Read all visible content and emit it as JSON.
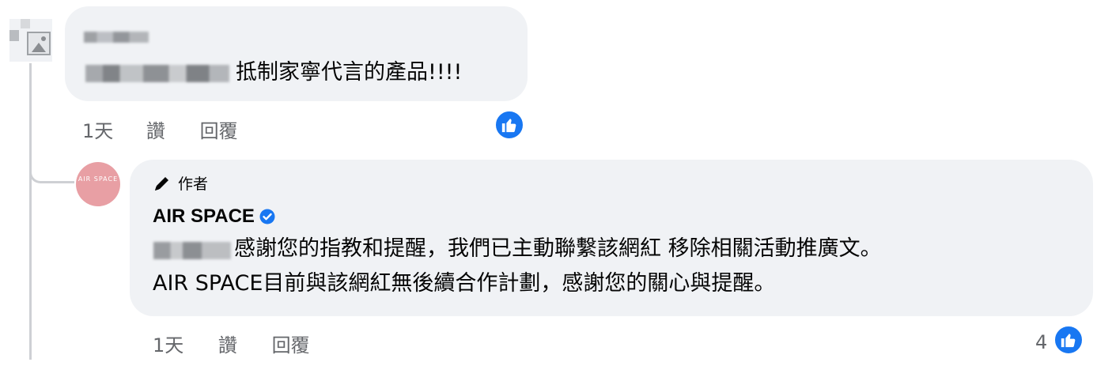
{
  "comment": {
    "text": "抵制家寧代言的產品!!!!",
    "time": "1天",
    "like_label": "讚",
    "reply_label": "回覆"
  },
  "reply": {
    "author_badge": "作者",
    "author_name": "AIR SPACE",
    "avatar_text": "AIR SPACE",
    "line1": "感謝您的指教和提醒，我們已主動聯繫該網紅 移除相關活動推廣文。",
    "line2": "AIR SPACE目前與該網紅無後續合作計劃，感謝您的關心與提醒。",
    "time": "1天",
    "like_label": "讚",
    "reply_label": "回覆",
    "reaction_count": "4"
  },
  "colors": {
    "bubble": "#f0f2f5",
    "like_blue": "#1877f2",
    "meta_gray": "#65676b",
    "avatar_pink": "#e89fa4"
  },
  "icons": {
    "reaction": "thumbs-up-icon",
    "author": "pencil-icon",
    "verified": "verified-badge-icon"
  }
}
